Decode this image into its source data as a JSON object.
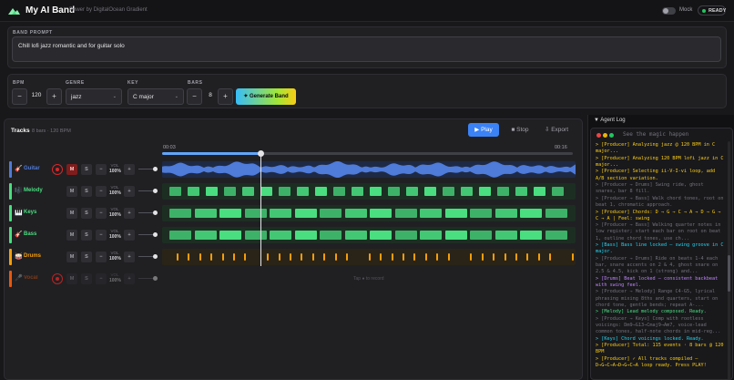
{
  "app": {
    "title": "My AI Band",
    "powered_by": "Power by DigitalOcean Gradient",
    "mock_label": "Mock",
    "status": "READY"
  },
  "prompt": {
    "label": "BAND PROMPT",
    "value": "Chill lofi jazz romantic and for guitar solo"
  },
  "controls": {
    "bpm_label": "BPM",
    "bpm_value": "120",
    "genre_label": "GENRE",
    "genre_value": "jazz",
    "key_label": "KEY",
    "key_value": "C major",
    "bars_label": "BARS",
    "bars_value": "8",
    "generate_label": "✦ Generate Band",
    "minus": "−",
    "plus": "+"
  },
  "tracks_panel": {
    "title": "Tracks",
    "meta": "8 bars · 120 BPM",
    "play_label": "▶ Play",
    "stop_label": "■ Stop",
    "export_label": "⇩ Export",
    "time_start": "00:03",
    "time_end": "00:16",
    "progress": 0.24,
    "mute_label": "M",
    "solo_label": "S",
    "vol_label": "VOL",
    "vol_value": "100%"
  },
  "tracks": [
    {
      "name": "Guitar",
      "icon": "🎸",
      "color": "#4f7bd9"
    },
    {
      "name": "Melody",
      "icon": "🎼",
      "color": "#4ade80"
    },
    {
      "name": "Keys",
      "icon": "🎹",
      "color": "#4ade80"
    },
    {
      "name": "Bass",
      "icon": "🎸",
      "color": "#4ade80"
    },
    {
      "name": "Drums",
      "icon": "🥁",
      "color": "#f59e0b"
    },
    {
      "name": "Vocal",
      "icon": "🎤",
      "color": "#ea580c",
      "lane_text": "Tap ● to record"
    }
  ],
  "agent_log": {
    "header": "▼ Agent Log",
    "terminal_title": "See the magic happen",
    "lines": [
      {
        "text": "> [Producer] Analyzing jazz @ 120 BPM in C major...",
        "color": "#facc15"
      },
      {
        "text": "> [Producer] Analyzing 120 BPM lofi jazz in C major...",
        "color": "#facc15"
      },
      {
        "text": "> [Producer] Selecting ii-V-I-vi loop, add A/B section variation.",
        "color": "#facc15"
      },
      {
        "text": "> [Producer → Drums] Swing ride, ghost snares, bar 8 fill.",
        "color": "#71717a"
      },
      {
        "text": "> [Producer → Bass] Walk chord tones, root on beat 1, chromatic approach.",
        "color": "#71717a"
      },
      {
        "text": "> [Producer] Chords: D → G → C → A → D → G → C → A | Feel: swing",
        "color": "#facc15"
      },
      {
        "text": "> [Producer → Bass] Walking quarter notes in low register; start each bar on root on beat 1, outline chord tones, use ch...",
        "color": "#71717a"
      },
      {
        "text": "> [Bass] Bass line locked — swing groove in C major.",
        "color": "#22d3ee"
      },
      {
        "text": "> [Producer → Drums] Ride on beats 1-4 each bar, snare accents on 2 & 4, ghost snare on 2.5 & 4.5, kick on 1 (strong) and...",
        "color": "#71717a"
      },
      {
        "text": "> [Drums] Beat locked — consistent backbeat with swing feel.",
        "color": "#c084fc"
      },
      {
        "text": "> [Producer → Melody] Range C4-G5, lyrical phrasing mixing 8ths and quarters, start on chord tone, gentle bends; repeat A-...",
        "color": "#71717a"
      },
      {
        "text": "> [Melody] Lead melody composed. Ready.",
        "color": "#4ade80"
      },
      {
        "text": "> [Producer → Keys] Comp with rootless voicings: Dm9→G13→Cmaj9→Am7, voice-lead common tones, half-note chords in mid-reg...",
        "color": "#71717a"
      },
      {
        "text": "> [Keys] Chord voicings locked. Ready.",
        "color": "#22d3ee"
      },
      {
        "text": "> [Producer] Total: 115 events · 8 bars @ 120 BPM",
        "color": "#facc15"
      },
      {
        "text": "> [Producer] ✓ All tracks compiled — D→G→C→A→D→G→C→A loop ready. Press PLAY!",
        "color": "#facc15"
      }
    ]
  }
}
